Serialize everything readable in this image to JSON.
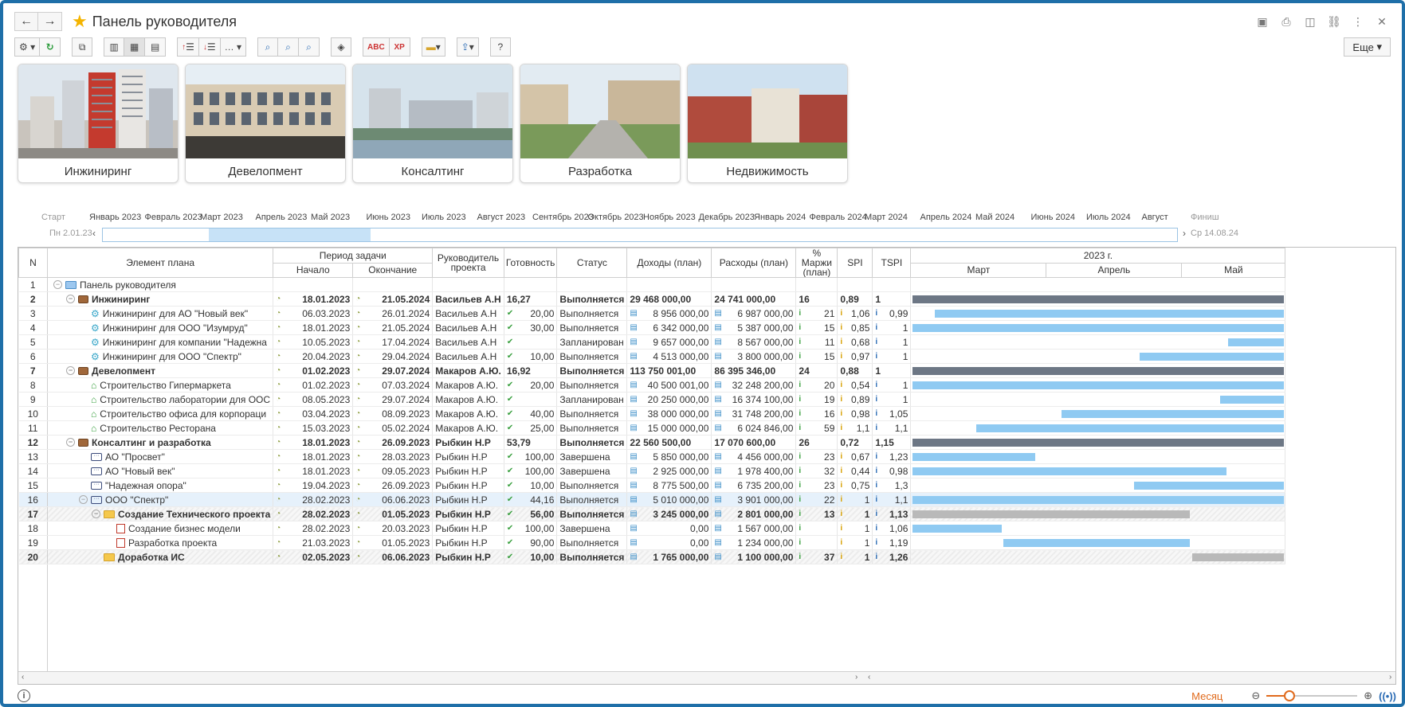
{
  "window": {
    "title": "Панель руководителя",
    "more_label": "Еще"
  },
  "tiles": [
    {
      "label": "Инжиниринг"
    },
    {
      "label": "Девелопмент"
    },
    {
      "label": "Консалтинг"
    },
    {
      "label": "Разработка"
    },
    {
      "label": "Недвижимость"
    }
  ],
  "timeline": {
    "start_label": "Старт",
    "start_date": "Пн 2.01.23",
    "end_label": "Финиш",
    "end_date": "Ср 14.08.24",
    "months": [
      "Январь 2023",
      "Февраль 2023",
      "Март 2023",
      "Апрель 2023",
      "Май 2023",
      "Июнь 2023",
      "Июль 2023",
      "Август 2023",
      "Сентябрь 2023",
      "Октябрь 2023",
      "Ноябрь 2023",
      "Декабрь 2023",
      "Январь 2024",
      "Февраль 2024",
      "Март 2024",
      "Апрель 2024",
      "Май 2024",
      "Июнь 2024",
      "Июль 2024",
      "Август"
    ]
  },
  "columns": {
    "n": "N",
    "element": "Элемент плана",
    "period": "Период задачи",
    "start": "Начало",
    "end": "Окончание",
    "manager": "Руководитель проекта",
    "ready": "Готовность",
    "status": "Статус",
    "income": "Доходы (план)",
    "expense": "Расходы (план)",
    "margin": "% Маржи (план)",
    "spi": "SPI",
    "tspi": "TSPI",
    "gantt_year": "2023 г.",
    "gantt_months": [
      "Март",
      "Апрель",
      "Май"
    ]
  },
  "rows": [
    {
      "n": "1",
      "name": "Панель руководителя",
      "level": 0,
      "toggle": "⊖",
      "icon": "folderblue",
      "bold": false,
      "start": "",
      "end": "",
      "manager": "",
      "ready": "",
      "status": "",
      "income": "",
      "expense": "",
      "margin": "",
      "spi": "",
      "tspi": "",
      "bar": null,
      "hasmini": false
    },
    {
      "n": "2",
      "name": "Инжиниринг",
      "level": 1,
      "toggle": "⊖",
      "icon": "brief",
      "bold": true,
      "start": "18.01.2023",
      "end": "21.05.2024",
      "manager": "Васильев А.Н",
      "ready": "16,27",
      "status": "Выполняется",
      "income": "29 468 000,00",
      "expense": "24 741 000,00",
      "margin": "16",
      "spi": "0,89",
      "tspi": "1",
      "bar": {
        "type": "dark",
        "from": 0.0,
        "to": 1.0
      },
      "hasmini": false
    },
    {
      "n": "3",
      "name": "Инжиниринг для АО \"Новый век\"",
      "level": 2,
      "toggle": "",
      "icon": "gear",
      "bold": false,
      "start": "06.03.2023",
      "end": "26.01.2024",
      "manager": "Васильев А.Н",
      "ready": "20,00",
      "status": "Выполняется",
      "income": "8 956 000,00",
      "expense": "6 987 000,00",
      "margin": "21",
      "spi": "1,06",
      "tspi": "0,99",
      "bar": {
        "type": "blue",
        "from": 0.06,
        "to": 1.0
      },
      "hasmini": true
    },
    {
      "n": "4",
      "name": "Инжиниринг для ООО \"Изумруд\"",
      "level": 2,
      "toggle": "",
      "icon": "gear",
      "bold": false,
      "start": "18.01.2023",
      "end": "21.05.2024",
      "manager": "Васильев А.Н",
      "ready": "30,00",
      "status": "Выполняется",
      "income": "6 342 000,00",
      "expense": "5 387 000,00",
      "margin": "15",
      "spi": "0,85",
      "tspi": "1",
      "bar": {
        "type": "blue",
        "from": 0.0,
        "to": 1.0
      },
      "hasmini": true
    },
    {
      "n": "5",
      "name": "Инжиниринг для компании \"Надежна",
      "level": 2,
      "toggle": "",
      "icon": "gear",
      "bold": false,
      "start": "10.05.2023",
      "end": "17.04.2024",
      "manager": "Васильев А.Н",
      "ready": "",
      "status": "Запланирован",
      "income": "9 657 000,00",
      "expense": "8 567 000,00",
      "margin": "11",
      "spi": "0,68",
      "tspi": "1",
      "bar": {
        "type": "blue",
        "from": 0.85,
        "to": 1.0
      },
      "hasmini": true
    },
    {
      "n": "6",
      "name": "Инжиниринг для ООО \"Спектр\"",
      "level": 2,
      "toggle": "",
      "icon": "gear",
      "bold": false,
      "start": "20.04.2023",
      "end": "29.04.2024",
      "manager": "Васильев А.Н",
      "ready": "10,00",
      "status": "Выполняется",
      "income": "4 513 000,00",
      "expense": "3 800 000,00",
      "margin": "15",
      "spi": "0,97",
      "tspi": "1",
      "bar": {
        "type": "blue",
        "from": 0.61,
        "to": 1.0
      },
      "hasmini": true
    },
    {
      "n": "7",
      "name": "Девелопмент",
      "level": 1,
      "toggle": "⊖",
      "icon": "brief",
      "bold": true,
      "start": "01.02.2023",
      "end": "29.07.2024",
      "manager": "Макаров А.Ю.",
      "ready": "16,92",
      "status": "Выполняется",
      "income": "113 750 001,00",
      "expense": "86 395 346,00",
      "margin": "24",
      "spi": "0,88",
      "tspi": "1",
      "bar": {
        "type": "dark",
        "from": 0.0,
        "to": 1.0
      },
      "hasmini": false
    },
    {
      "n": "8",
      "name": "Строительство Гипермаркета",
      "level": 2,
      "toggle": "",
      "icon": "house",
      "bold": false,
      "start": "01.02.2023",
      "end": "07.03.2024",
      "manager": "Макаров А.Ю.",
      "ready": "20,00",
      "status": "Выполняется",
      "income": "40 500 001,00",
      "expense": "32 248 200,00",
      "margin": "20",
      "spi": "0,54",
      "tspi": "1",
      "bar": {
        "type": "blue",
        "from": 0.0,
        "to": 1.0
      },
      "hasmini": true
    },
    {
      "n": "9",
      "name": "Строительство лаборатории для ООС",
      "level": 2,
      "toggle": "",
      "icon": "house",
      "bold": false,
      "start": "08.05.2023",
      "end": "29.07.2024",
      "manager": "Макаров А.Ю.",
      "ready": "",
      "status": "Запланирован",
      "income": "20 250 000,00",
      "expense": "16 374 100,00",
      "margin": "19",
      "spi": "0,89",
      "tspi": "1",
      "bar": {
        "type": "blue",
        "from": 0.827,
        "to": 1.0
      },
      "hasmini": true
    },
    {
      "n": "10",
      "name": "Строительство офиса для корпораци",
      "level": 2,
      "toggle": "",
      "icon": "house",
      "bold": false,
      "start": "03.04.2023",
      "end": "08.09.2023",
      "manager": "Макаров А.Ю.",
      "ready": "40,00",
      "status": "Выполняется",
      "income": "38 000 000,00",
      "expense": "31 748 200,00",
      "margin": "16",
      "spi": "0,98",
      "tspi": "1,05",
      "bar": {
        "type": "blue",
        "from": 0.4,
        "to": 1.0
      },
      "hasmini": true
    },
    {
      "n": "11",
      "name": "Строительство Ресторана",
      "level": 2,
      "toggle": "",
      "icon": "house",
      "bold": false,
      "start": "15.03.2023",
      "end": "05.02.2024",
      "manager": "Макаров А.Ю.",
      "ready": "25,00",
      "status": "Выполняется",
      "income": "15 000 000,00",
      "expense": "6 024 846,00",
      "margin": "59",
      "spi": "1,1",
      "tspi": "1,1",
      "bar": {
        "type": "blue",
        "from": 0.17,
        "to": 1.0
      },
      "hasmini": true
    },
    {
      "n": "12",
      "name": "Консалтинг и разработка",
      "level": 1,
      "toggle": "⊖",
      "icon": "brief",
      "bold": true,
      "start": "18.01.2023",
      "end": "26.09.2023",
      "manager": "Рыбкин Н.Р",
      "ready": "53,79",
      "status": "Выполняется",
      "income": "22 560 500,00",
      "expense": "17 070 600,00",
      "margin": "26",
      "spi": "0,72",
      "tspi": "1,15",
      "bar": {
        "type": "dark",
        "from": 0.0,
        "to": 1.0
      },
      "hasmini": false
    },
    {
      "n": "13",
      "name": "АО \"Просвет\"",
      "level": 2,
      "toggle": "",
      "icon": "chat",
      "bold": false,
      "start": "18.01.2023",
      "end": "28.03.2023",
      "manager": "Рыбкин Н.Р",
      "ready": "100,00",
      "status": "Завершена",
      "income": "5 850 000,00",
      "expense": "4 456 000,00",
      "margin": "23",
      "spi": "0,67",
      "tspi": "1,23",
      "bar": {
        "type": "blue",
        "from": 0.0,
        "to": 0.33
      },
      "hasmini": true
    },
    {
      "n": "14",
      "name": "АО \"Новый век\"",
      "level": 2,
      "toggle": "",
      "icon": "chat",
      "bold": false,
      "start": "18.01.2023",
      "end": "09.05.2023",
      "manager": "Рыбкин Н.Р",
      "ready": "100,00",
      "status": "Завершена",
      "income": "2 925 000,00",
      "expense": "1 978 400,00",
      "margin": "32",
      "spi": "0,44",
      "tspi": "0,98",
      "bar": {
        "type": "blue",
        "from": 0.0,
        "to": 0.845
      },
      "hasmini": true
    },
    {
      "n": "15",
      "name": "\"Надежная опора\"",
      "level": 2,
      "toggle": "",
      "icon": "chat",
      "bold": false,
      "start": "19.04.2023",
      "end": "26.09.2023",
      "manager": "Рыбкин Н.Р",
      "ready": "10,00",
      "status": "Выполняется",
      "income": "8 775 500,00",
      "expense": "6 735 200,00",
      "margin": "23",
      "spi": "0,75",
      "tspi": "1,3",
      "bar": {
        "type": "blue",
        "from": 0.595,
        "to": 1.0
      },
      "hasmini": true
    },
    {
      "n": "16",
      "name": "ООО \"Спектр\"",
      "level": 2,
      "toggle": "⊖",
      "icon": "chat",
      "bold": false,
      "sel": true,
      "start": "28.02.2023",
      "end": "06.06.2023",
      "manager": "Рыбкин Н.Р",
      "ready": "44,16",
      "status": "Выполняется",
      "income": "5 010 000,00",
      "expense": "3 901 000,00",
      "margin": "22",
      "spi": "1",
      "tspi": "1,1",
      "bar": {
        "type": "blue",
        "from": 0.0,
        "to": 1.0
      },
      "hasmini": true
    },
    {
      "n": "17",
      "name": "Создание Технического проекта",
      "level": 3,
      "toggle": "⊖",
      "icon": "folder",
      "bold": true,
      "hatch": true,
      "start": "28.02.2023",
      "end": "01.05.2023",
      "manager": "Рыбкин Н.Р",
      "ready": "56,00",
      "status": "Выполняется",
      "income": "3 245 000,00",
      "expense": "2 801 000,00",
      "margin": "13",
      "spi": "1",
      "tspi": "1,13",
      "bar": {
        "type": "gray",
        "from": 0.0,
        "to": 0.745
      },
      "hasmini": true
    },
    {
      "n": "18",
      "name": "Создание бизнес модели",
      "level": 4,
      "toggle": "",
      "icon": "doc",
      "bold": false,
      "start": "28.02.2023",
      "end": "20.03.2023",
      "manager": "Рыбкин Н.Р",
      "ready": "100,00",
      "status": "Завершена",
      "income": "0,00",
      "expense": "1 567 000,00",
      "margin": "",
      "spi": "1",
      "tspi": "1,06",
      "bar": {
        "type": "blue",
        "from": 0.0,
        "to": 0.24
      },
      "hasmini": true
    },
    {
      "n": "19",
      "name": "Разработка проекта",
      "level": 4,
      "toggle": "",
      "icon": "doc",
      "bold": false,
      "start": "21.03.2023",
      "end": "01.05.2023",
      "manager": "Рыбкин Н.Р",
      "ready": "90,00",
      "status": "Выполняется",
      "income": "0,00",
      "expense": "1 234 000,00",
      "margin": "",
      "spi": "1",
      "tspi": "1,19",
      "bar": {
        "type": "blue",
        "from": 0.243,
        "to": 0.745
      },
      "hasmini": true
    },
    {
      "n": "20",
      "name": "Доработка ИС",
      "level": 3,
      "toggle": "",
      "icon": "folder",
      "bold": true,
      "hatch": true,
      "start": "02.05.2023",
      "end": "06.06.2023",
      "manager": "Рыбкин Н.Р",
      "ready": "10,00",
      "status": "Выполняется",
      "income": "1 765 000,00",
      "expense": "1 100 000,00",
      "margin": "37",
      "spi": "1",
      "tspi": "1,26",
      "bar": {
        "type": "gray",
        "from": 0.752,
        "to": 1.0
      },
      "hasmini": true
    }
  ],
  "footer": {
    "scale_label": "Месяц",
    "zoom_level": 0.25
  }
}
